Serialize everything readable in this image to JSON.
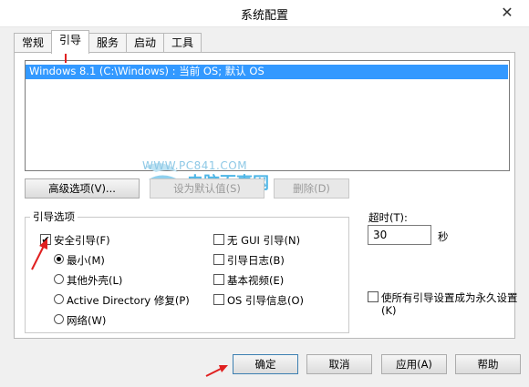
{
  "window": {
    "title": "系统配置",
    "close_glyph": "✕"
  },
  "tabs": [
    {
      "label": "常规"
    },
    {
      "label": "引导"
    },
    {
      "label": "服务"
    },
    {
      "label": "启动"
    },
    {
      "label": "工具"
    }
  ],
  "os_list": {
    "items": [
      "Windows 8.1 (C:\\Windows) : 当前 OS; 默认 OS"
    ]
  },
  "buttons": {
    "advanced": "高级选项(V)...",
    "set_default": "设为默认值(S)",
    "delete": "删除(D)"
  },
  "boot_options": {
    "group_label": "引导选项",
    "safe_boot": {
      "label": "安全引导(F)",
      "checked": true
    },
    "radios": [
      {
        "label": "最小(M)",
        "checked": true
      },
      {
        "label": "其他外壳(L)",
        "checked": false
      },
      {
        "label": "Active Directory 修复(P)",
        "checked": false
      },
      {
        "label": "网络(W)",
        "checked": false
      }
    ],
    "checks": [
      {
        "label": "无 GUI 引导(N)",
        "checked": false
      },
      {
        "label": "引导日志(B)",
        "checked": false
      },
      {
        "label": "基本视频(E)",
        "checked": false
      },
      {
        "label": "OS 引导信息(O)",
        "checked": false
      }
    ]
  },
  "timeout": {
    "label": "超时(T):",
    "value": "30",
    "unit": "秒"
  },
  "permanent": {
    "label_line1": "使所有引导设置成为永久设置",
    "label_line2": "(K)",
    "checked": false
  },
  "dialog_buttons": {
    "ok": "确定",
    "cancel": "取消",
    "apply": "应用(A)",
    "help": "帮助"
  },
  "watermark": {
    "url": "WWW.PC841.COM",
    "text": "电脑百事网"
  },
  "colors": {
    "selection": "#3399ff",
    "annotation_arrow": "#e02020",
    "watermark": "#4fb6e6"
  }
}
